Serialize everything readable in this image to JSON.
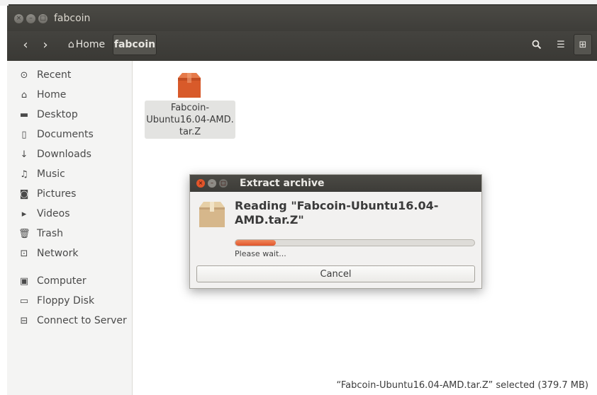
{
  "window": {
    "title": "fabcoin",
    "close_glyph": "×",
    "minimize_glyph": "–",
    "maximize_glyph": "□"
  },
  "toolbar": {
    "back_glyph": "‹",
    "forward_glyph": "›",
    "home_icon": "⌂",
    "home_label": "Home",
    "current_label": "fabcoin",
    "search_glyph": "🔍",
    "list_view_glyph": "☰",
    "grid_view_glyph": "⊞"
  },
  "sidebar": {
    "items": [
      {
        "icon": "⊙",
        "label": "Recent"
      },
      {
        "icon": "⌂",
        "label": "Home"
      },
      {
        "icon": "▬",
        "label": "Desktop"
      },
      {
        "icon": "▯",
        "label": "Documents"
      },
      {
        "icon": "↓",
        "label": "Downloads"
      },
      {
        "icon": "♫",
        "label": "Music"
      },
      {
        "icon": "◙",
        "label": "Pictures"
      },
      {
        "icon": "▸",
        "label": "Videos"
      },
      {
        "icon": "🗑",
        "label": "Trash"
      },
      {
        "icon": "⊡",
        "label": "Network"
      },
      {
        "icon": "▣",
        "label": "Computer"
      },
      {
        "icon": "▭",
        "label": "Floppy Disk"
      },
      {
        "icon": "⊟",
        "label": "Connect to Server"
      }
    ]
  },
  "content": {
    "file_name": "Fabcoin-Ubuntu16.04-AMD.tar.Z",
    "file_line1": "Fabcoin-",
    "file_line2": "Ubuntu16.04-AMD.",
    "file_line3": "tar.Z",
    "status": "“Fabcoin-Ubuntu16.04-AMD.tar.Z” selected  (379.7 MB)"
  },
  "dialog": {
    "title": "Extract archive",
    "message_line1": "Reading \"Fabcoin-Ubuntu16.04-",
    "message_line2": "AMD.tar.Z\"",
    "progress_fraction": 0.17,
    "wait_text": "Please wait...",
    "cancel_label": "Cancel"
  },
  "colors": {
    "accent": "#e1542a",
    "titlebar": "#3e3d39",
    "package_orange": "#d85a2a",
    "package_tan": "#d6b78b"
  }
}
